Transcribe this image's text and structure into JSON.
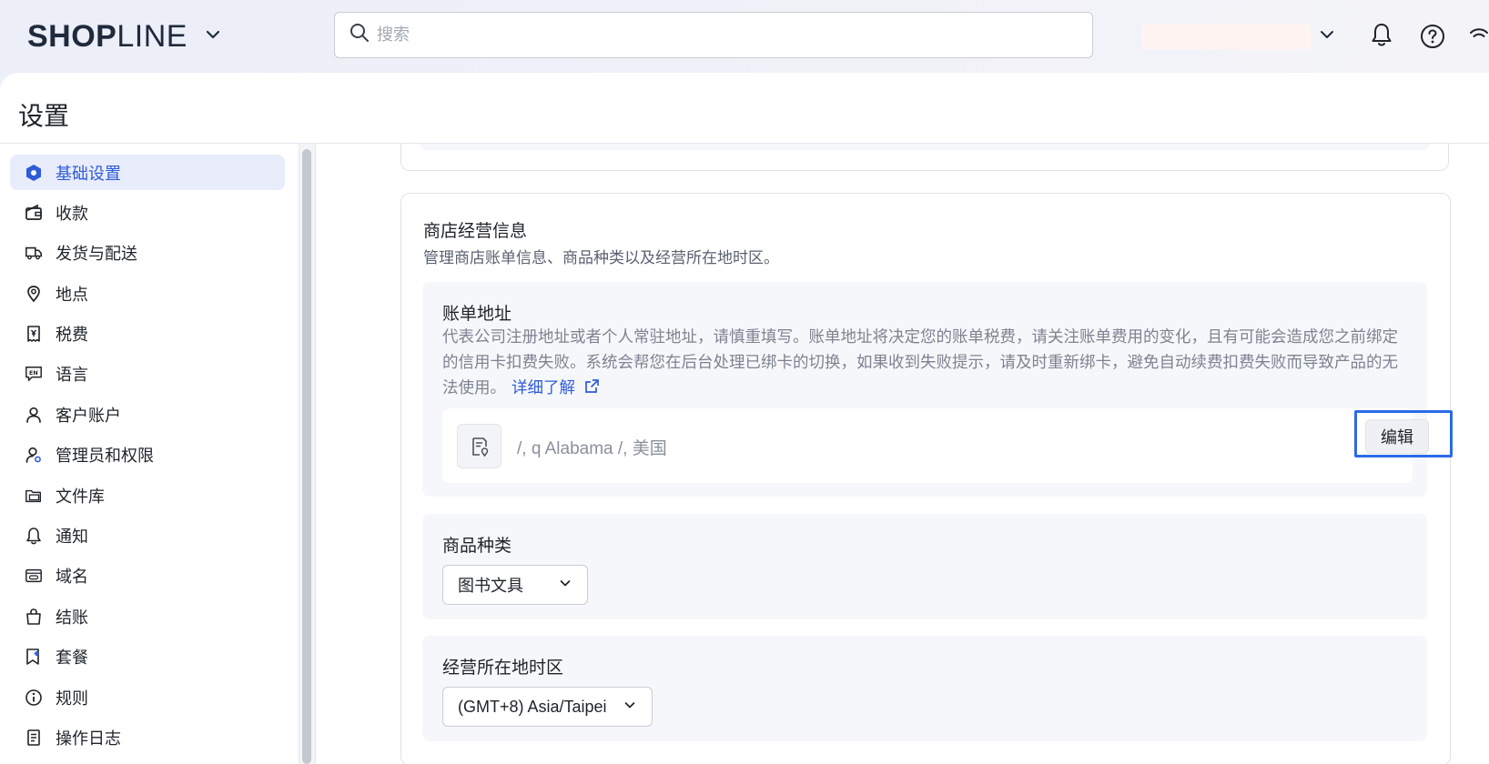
{
  "topbar": {
    "logo_bold": "SHOP",
    "logo_light": "LINE",
    "search_placeholder": "搜索"
  },
  "page_title": "设置",
  "sidebar": {
    "items": [
      {
        "label": "基础设置",
        "icon": "hexagon-icon",
        "active": true
      },
      {
        "label": "收款",
        "icon": "wallet-icon"
      },
      {
        "label": "发货与配送",
        "icon": "truck-icon"
      },
      {
        "label": "地点",
        "icon": "location-pin-icon"
      },
      {
        "label": "税费",
        "icon": "receipt-icon"
      },
      {
        "label": "语言",
        "icon": "language-icon"
      },
      {
        "label": "客户账户",
        "icon": "user-icon"
      },
      {
        "label": "管理员和权限",
        "icon": "admin-user-icon"
      },
      {
        "label": "文件库",
        "icon": "folder-icon"
      },
      {
        "label": "通知",
        "icon": "bell-icon"
      },
      {
        "label": "域名",
        "icon": "domain-icon"
      },
      {
        "label": "结账",
        "icon": "shopping-bag-icon"
      },
      {
        "label": "套餐",
        "icon": "plan-icon"
      },
      {
        "label": "规则",
        "icon": "info-icon"
      },
      {
        "label": "操作日志",
        "icon": "log-icon"
      }
    ]
  },
  "card": {
    "title": "商店经营信息",
    "description": "管理商店账单信息、商品种类以及经营所在地时区。",
    "billing": {
      "title": "账单地址",
      "description": "代表公司注册地址或者个人常驻地址，请慎重填写。账单地址将决定您的账单税费，请关注账单费用的变化，且有可能会造成您之前绑定的信用卡扣费失败。系统会帮您在后台处理已绑卡的切换，如果收到失败提示，请及时重新绑卡，避免自动续费扣费失败而导致产品的无法使用。",
      "learn_more": "详细了解",
      "address": "/, q Alabama /, 美国",
      "edit_label": "编辑"
    },
    "category": {
      "title": "商品种类",
      "selected": "图书文具"
    },
    "timezone": {
      "title": "经营所在地时区",
      "selected": "(GMT+8) Asia/Taipei"
    }
  },
  "colors": {
    "accent": "#2e5bd8",
    "highlight_outline": "#2b6ae8",
    "active_bg": "#e8ecfb"
  }
}
